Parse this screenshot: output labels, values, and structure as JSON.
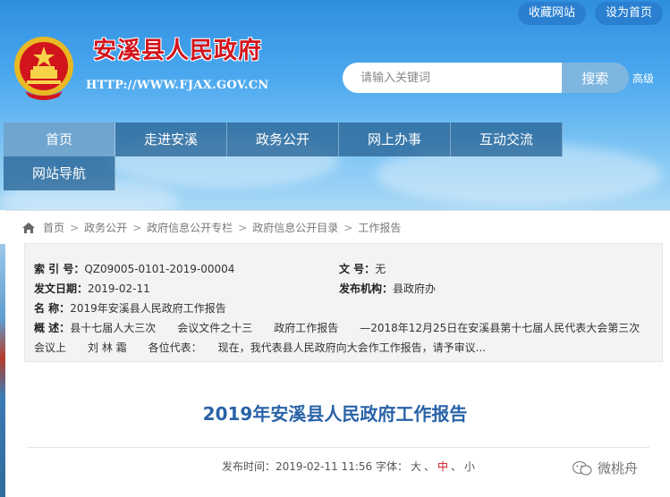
{
  "header": {
    "top_links": [
      "收藏网站",
      "设为首页"
    ],
    "site_title": "安溪县人民政府",
    "site_url": "HTTP://WWW.FJAX.GOV.CN",
    "search_placeholder": "请输入关键词",
    "search_button": "搜索",
    "advanced_link": "高级"
  },
  "nav": {
    "items": [
      "首页",
      "走进安溪",
      "政务公开",
      "网上办事",
      "互动交流",
      "网站导航"
    ],
    "active": "首页"
  },
  "breadcrumb": [
    "首页",
    "政务公开",
    "政府信息公开专栏",
    "政府信息公开目录",
    "工作报告"
  ],
  "info": {
    "index_label": "索 引 号：",
    "index_value": "QZ09005-0101-2019-00004",
    "doc_no_label": "文 号：",
    "doc_no_value": "无",
    "date_label": "发文日期：",
    "date_value": "2019-02-11",
    "org_label": "发布机构：",
    "org_value": "县政府办",
    "name_label": "名 称：",
    "name_value": "2019年安溪县人民政府工作报告",
    "summary_label": "概 述：",
    "summary_line1": "县十七届人大三次　　会议文件之十三　　政府工作报告　　—2018年12月25日在安溪县第十七届人民代表大会第三次",
    "summary_line2": "会议上　　刘 林 霜　　各位代表：　　现在，我代表县人民政府向大会作工作报告，请予审议..."
  },
  "article": {
    "title": "2019年安溪县人民政府工作报告",
    "meta_prefix": "发布时间：2019-02-11 11:56 字体：",
    "font_sizes": [
      "大",
      "中",
      "小"
    ],
    "font_size_selected": "中"
  },
  "watermark": "微桃舟",
  "colors": {
    "title_red": "#d2141c",
    "article_blue": "#2a63a8",
    "nav_bg": "#28648f"
  }
}
